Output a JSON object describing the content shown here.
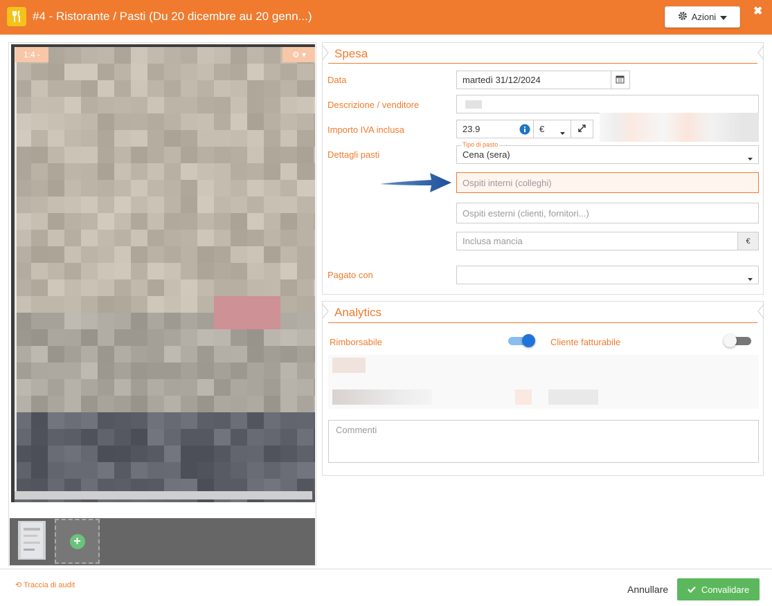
{
  "header": {
    "title": "#4 -  Ristorante / Pasti (Du 20 dicembre au 20 genn...)",
    "actions_label": "Azioni",
    "color": "#f07a2e"
  },
  "viewer": {
    "page_badge": "1:4 -"
  },
  "spesa": {
    "title": "Spesa",
    "data_label": "Data",
    "data_value": "martedì 31/12/2024",
    "descrizione_label": "Descrizione / venditore",
    "importo_label": "Importo IVA inclusa",
    "importo_value": "23.9",
    "currency": "€",
    "dettagli_label": "Dettagli pasti",
    "tipo_pasto_label": "Tipo di pasto",
    "tipo_pasto_value": "Cena (sera)",
    "ospiti_interni_placeholder": "Ospiti interni (colleghi)",
    "ospiti_esterni_placeholder": "Ospiti esterni (clienti, fornitori...)",
    "mancia_placeholder": "Inclusa mancia",
    "mancia_unit": "€",
    "pagato_label": "Pagato con",
    "pagato_value": ""
  },
  "analytics": {
    "title": "Analytics",
    "rimborsabile_label": "Rimborsabile",
    "rimborsabile_on": true,
    "cliente_label": "Cliente fatturabile",
    "cliente_on": false,
    "commenti_placeholder": "Commenti"
  },
  "footer": {
    "audit_label": "Traccia di audit",
    "cancel_label": "Annullare",
    "confirm_label": "Convalidare",
    "confirm_color": "#5cb85c"
  }
}
